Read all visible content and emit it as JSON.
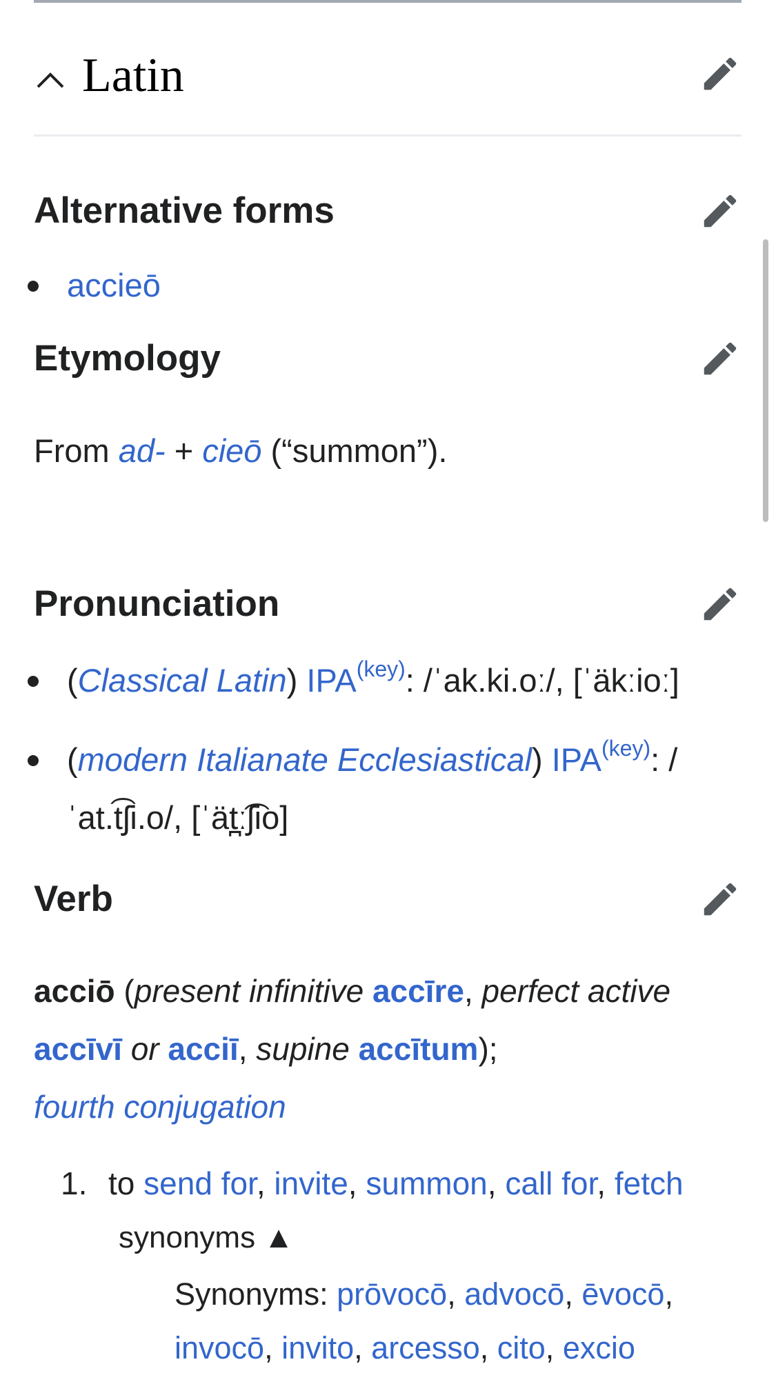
{
  "language": {
    "title": "Latin",
    "collapse_icon": "chevron-up-icon",
    "edit_icon": "pencil-icon"
  },
  "alt_forms": {
    "heading": "Alternative forms",
    "items": [
      "accieō"
    ]
  },
  "etymology": {
    "heading": "Etymology",
    "from": "From",
    "ad": "ad-",
    "plus": "+",
    "cieo": "cieō",
    "gloss": "(“summon”)."
  },
  "pronunciation": {
    "heading": "Pronunciation",
    "items": [
      {
        "open": "(",
        "label": "Classical Latin",
        "close": ")",
        "ipa": "IPA",
        "key": "(key)",
        "text": ": /ˈak.ki.oː/, [ˈäkːioː]"
      },
      {
        "open": "(",
        "label": "modern Italianate Ecclesiastical",
        "close": ")",
        "ipa": "IPA",
        "key": "(key)",
        "text": ": /ˈat.t͡ʃi.o/, [ˈät̪ː͡ʃio]"
      }
    ]
  },
  "verb": {
    "heading": "Verb",
    "lemma": "acciō",
    "p1": "(",
    "present_infinitive_label": "present infinitive",
    "present_infinitive": "accīre",
    "sep1": ",",
    "perfect_active_label": "perfect active",
    "perfect_active": "accīvī",
    "or": "or",
    "perfect_active_alt": "acciī",
    "sep2": ",",
    "supine_label": "supine",
    "supine": "accītum",
    "p2": ");",
    "conjugation": "fourth conjugation",
    "senses": [
      {
        "number": "1.",
        "to": "to",
        "glosses": [
          "send for",
          "invite",
          "summon",
          "call for",
          "fetch"
        ],
        "comma": ",",
        "synonyms_toggle": "synonyms ▲",
        "synonyms_label": "Synonyms:",
        "synonyms": [
          "prōvocō",
          "advocō",
          "ēvocō",
          "invocō",
          "invito",
          "arcesso",
          "cito",
          "excio"
        ]
      }
    ]
  },
  "colors": {
    "link": "#3366cc",
    "text": "#202122",
    "rule": "#a2a9b1",
    "divider": "#eaecf0"
  }
}
